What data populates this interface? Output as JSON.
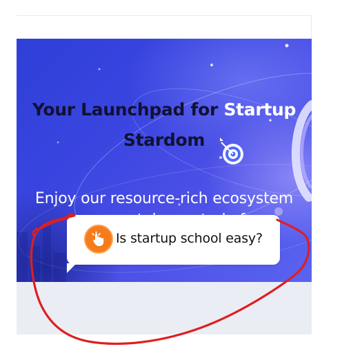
{
  "hero": {
    "headline_part1": "Your Launchpad for ",
    "headline_accent": "Startup",
    "headline_part2": "Stardom",
    "subline": "Enjoy our resource-rich ecosystem as you take control of"
  },
  "chat_bubble": {
    "message": "Is startup school easy?",
    "icon": "hand-pointer-icon"
  },
  "colors": {
    "hero_blue": "#3a45e0",
    "headline_text": "#111133",
    "accent_text": "#ffffff",
    "icon_orange": "#f57c1c",
    "annotation_red": "#dd1f1f",
    "section_gray": "#ebedf5"
  }
}
